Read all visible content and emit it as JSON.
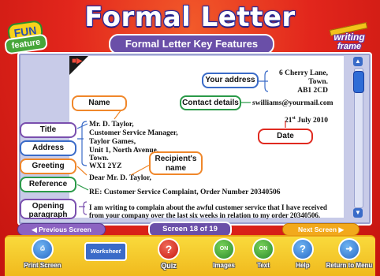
{
  "header": {
    "title": "Formal Letter",
    "subtitle": "Formal Letter Key Features",
    "fun_badge_top": "FUN",
    "fun_badge_bottom": "feature",
    "brand_line1": "writing",
    "brand_line2": "frame"
  },
  "speaker_icon": "speaker-icon",
  "letter": {
    "address_lines": [
      "6 Cherry Lane,",
      "Town.",
      "AB1 2CD"
    ],
    "email": "swilliams@yourmail.com",
    "date_day": "21",
    "date_sup": "st",
    "date_rest": "July 2010",
    "recipient_lines": [
      "Mr. D. Taylor,",
      "Customer Service Manager,",
      "Taylor Games,",
      "Unit 1, North Avenue,",
      "Town.",
      "WX1 2YZ"
    ],
    "greeting": "Dear Mr. D. Taylor,",
    "reference": "RE: Customer Service Complaint, Order Number 20340506",
    "body_line1": "I am writing to complain about the awful customer service that I have received",
    "body_line2": "from your company over the last six weeks in relation to my order 20340506."
  },
  "labels": {
    "your_address": "Your address",
    "contact_details": "Contact details",
    "date": "Date",
    "name": "Name",
    "title": "Title",
    "address": "Address",
    "greeting": "Greeting",
    "recipients_name_1": "Recipient's",
    "recipients_name_2": "name",
    "reference": "Reference",
    "opening_paragraph": "Opening paragraph"
  },
  "nav": {
    "previous": "Previous Screen",
    "next": "Next Screen",
    "screen_indicator": "Screen 18 of 19"
  },
  "toolbar": {
    "print": "Print Screen",
    "worksheet": "Worksheet",
    "quiz": "Quiz",
    "images_state": "ON",
    "images": "Images",
    "text_state": "ON",
    "text": "Text",
    "help": "Help",
    "return": "Return to Menu"
  },
  "colors": {
    "background": "#e2261c",
    "accent_purple": "#6a4fa8",
    "toolbar_yellow": "#f9da3c",
    "label_blue": "#3a6bc8",
    "label_orange": "#f0872a",
    "label_purple": "#7a4fae",
    "label_green": "#2a9a48",
    "label_red": "#e02a20"
  }
}
